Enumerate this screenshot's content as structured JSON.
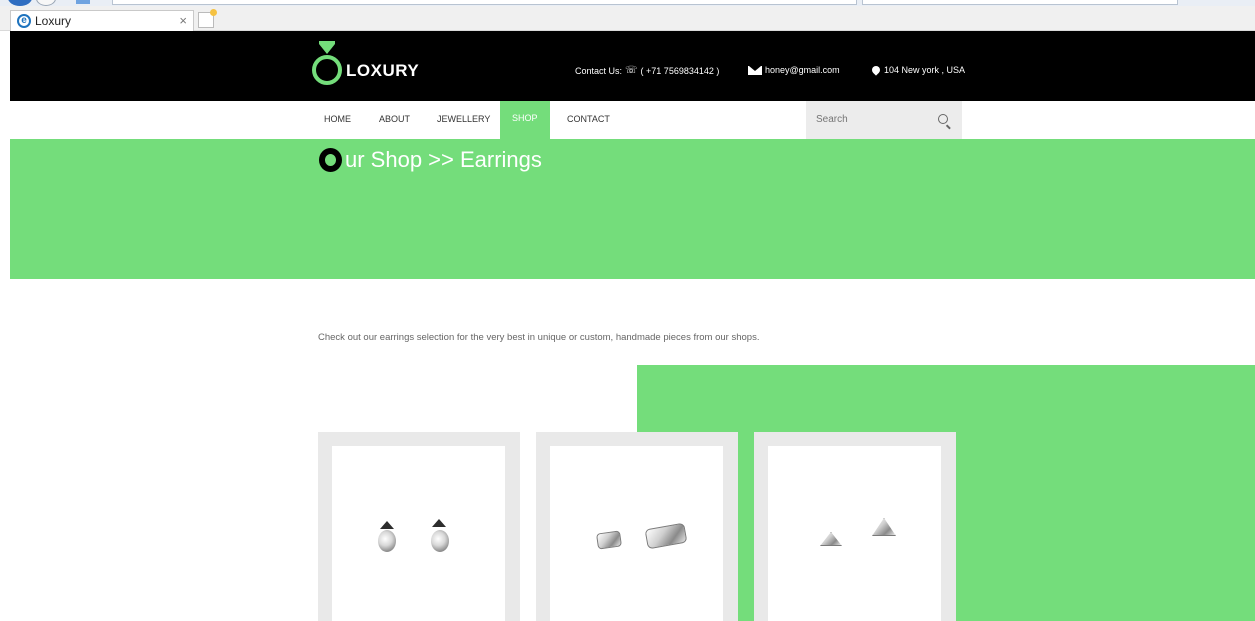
{
  "browser": {
    "tab_title": "Loxury",
    "tab_close": "×"
  },
  "header": {
    "logo_text": "LOXURY",
    "contact_label": "Contact Us:",
    "phone": "( +71 7569834142 )",
    "email": "honey@gmail.com",
    "location": "104 New york , USA"
  },
  "nav": {
    "items": [
      {
        "label": "HOME"
      },
      {
        "label": "ABOUT"
      },
      {
        "label": "JEWELLERY"
      },
      {
        "label": "SHOP"
      },
      {
        "label": "CONTACT"
      }
    ],
    "active": "SHOP",
    "search_placeholder": "Search"
  },
  "banner": {
    "title": "ur Shop >> Earrings"
  },
  "content": {
    "intro": "Check out our earrings selection for the very best in unique or custom, handmade pieces from our shops."
  },
  "colors": {
    "accent": "#74dd7b",
    "header_bg": "#000000"
  }
}
